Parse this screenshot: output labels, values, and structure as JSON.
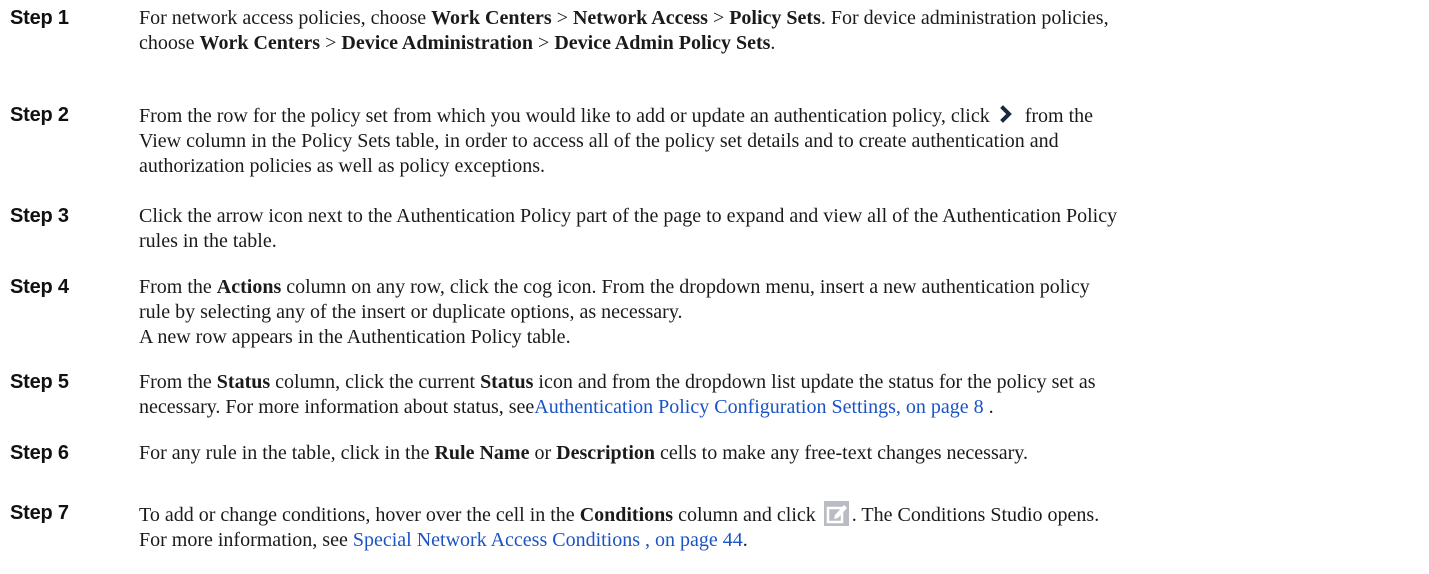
{
  "steps": [
    {
      "label": "Step 1",
      "t1": "For network access policies, choose ",
      "b1": "Work Centers",
      "t2": " > ",
      "b2": "Network Access",
      "t3": " > ",
      "b3": "Policy Sets",
      "t4": ". For device administration policies,",
      "t5": "choose ",
      "b4": "Work Centers",
      "t6": " > ",
      "b5": "Device Administration",
      "t7": " > ",
      "b6": "Device Admin Policy Sets",
      "t8": "."
    },
    {
      "label": "Step 2",
      "t1": "From the row for the policy set from which you would like to add or update an authentication policy, click",
      "t2": "from the",
      "t3": "View column in the Policy Sets table, in order to access all of the policy set details and to create authentication and",
      "t4": "authorization policies as well as policy exceptions."
    },
    {
      "label": "Step 3",
      "t1": "Click the arrow icon next to the Authentication Policy part of the page to expand and view all of the Authentication Policy",
      "t2": "rules in the table."
    },
    {
      "label": "Step 4",
      "t1": "From the ",
      "b1": "Actions",
      "t2": " column on any row, click the cog icon. From the dropdown menu, insert a new authentication policy",
      "t3": "rule by selecting any of the insert or duplicate options, as necessary.",
      "t4": "A new row appears in the Authentication Policy table."
    },
    {
      "label": "Step 5",
      "t1": "From the ",
      "b1": "Status",
      "t2": " column, click the current ",
      "b2": "Status",
      "t3": " icon and from the dropdown list update the status for the policy set as",
      "t4": "necessary. For more information about status, see",
      "link": "Authentication Policy Configuration Settings, on page 8",
      "t5": " ."
    },
    {
      "label": "Step 6",
      "t1": "For any rule in the table, click in the ",
      "b1": "Rule Name",
      "t2": " or ",
      "b2": "Description",
      "t3": " cells to make any free-text changes necessary."
    },
    {
      "label": "Step 7",
      "t1": "To add or change conditions, hover over the cell in the ",
      "b1": "Conditions",
      "t2": " column and click",
      "t3": ". The Conditions Studio opens.",
      "t4": "For more information, see ",
      "link": "Special Network Access Conditions , on page 44",
      "t5": "."
    }
  ],
  "icons": {
    "step2": "chevron-right-icon",
    "step7": "edit-icon"
  },
  "colors": {
    "link": "#1a53c6",
    "icon_bg": "#b9bdc3"
  }
}
